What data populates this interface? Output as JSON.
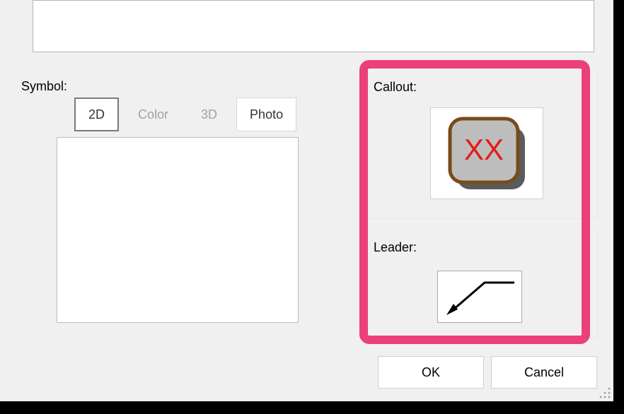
{
  "symbol": {
    "label": "Symbol:",
    "tabs": {
      "twoD": "2D",
      "color": "Color",
      "threeD": "3D",
      "photo": "Photo"
    }
  },
  "callout": {
    "label": "Callout:",
    "text": "XX"
  },
  "leader": {
    "label": "Leader:"
  },
  "buttons": {
    "ok": "OK",
    "cancel": "Cancel"
  }
}
